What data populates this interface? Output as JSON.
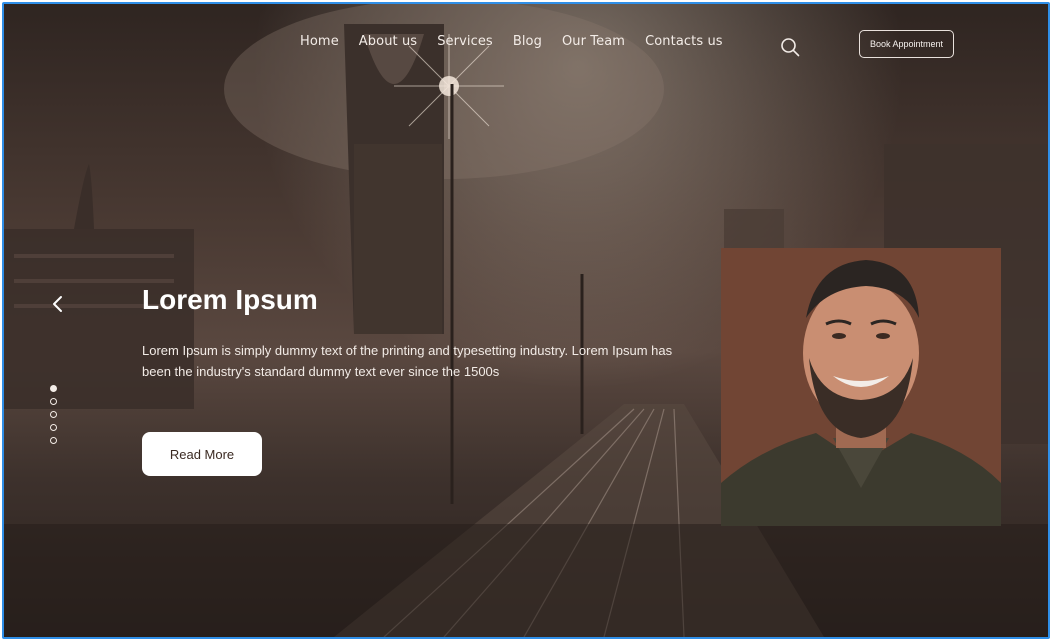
{
  "nav": {
    "items": [
      {
        "label": "Home"
      },
      {
        "label": "About us"
      },
      {
        "label": "Services"
      },
      {
        "label": "Blog"
      },
      {
        "label": "Our Team"
      },
      {
        "label": "Contacts us"
      }
    ],
    "search_icon": "search-icon",
    "cta_label": "Book Appointment"
  },
  "hero": {
    "title": "Lorem Ipsum",
    "description": "Lorem Ipsum is simply dummy text of the printing and typesetting industry. Lorem Ipsum has been the industry's standard dummy text ever since the 1500s",
    "button_label": "Read More",
    "slides_total": 5,
    "active_slide": 1
  },
  "colors": {
    "accent_border": "#2f8fe8",
    "portrait_bg": "#714534",
    "overlay": "#4a3a33"
  }
}
